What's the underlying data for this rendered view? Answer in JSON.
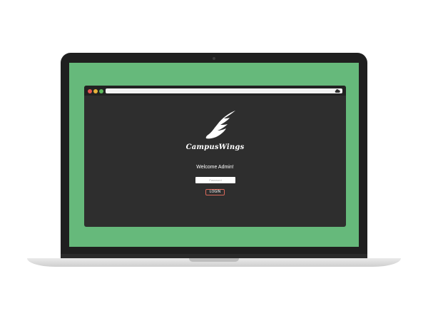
{
  "browser": {
    "window_buttons": [
      {
        "name": "close",
        "color": "#e4574f"
      },
      {
        "name": "minimize",
        "color": "#e7b13a"
      },
      {
        "name": "maximize",
        "color": "#5cb85c"
      }
    ],
    "address_bar": {
      "value": ""
    },
    "toolbar_icon": "cloud-icon"
  },
  "app": {
    "logo_icon": "wing-icon",
    "brand": "CampusWings",
    "welcome": "Welcome Admin!",
    "password_placeholder": "Password",
    "login_label": "LOGIN"
  },
  "colors": {
    "wallpaper": "#66b97b",
    "app_background": "#2e2e2e",
    "login_border": "#d9685a",
    "text": "#ffffff"
  }
}
